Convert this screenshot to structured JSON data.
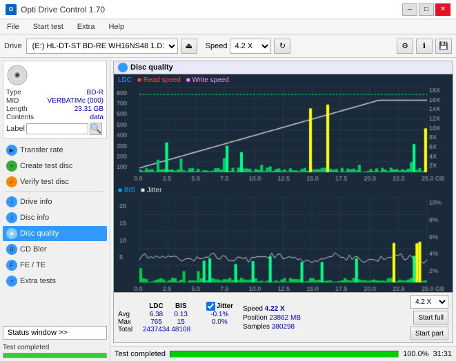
{
  "window": {
    "title": "Opti Drive Control 1.70",
    "controls": [
      "–",
      "□",
      "✕"
    ]
  },
  "menu": {
    "items": [
      "File",
      "Start test",
      "Extra",
      "Help"
    ]
  },
  "toolbar": {
    "drive_label": "Drive",
    "drive_value": "(E:)  HL-DT-ST BD-RE  WH16NS48 1.D3",
    "speed_label": "Speed",
    "speed_value": "4.2 X"
  },
  "disc": {
    "type_label": "Type",
    "type_value": "BD-R",
    "mid_label": "MID",
    "mid_value": "VERBATIMc (000)",
    "length_label": "Length",
    "length_value": "23.31 GB",
    "contents_label": "Contents",
    "contents_value": "data",
    "label_label": "Label",
    "label_value": ""
  },
  "sidebar": {
    "items": [
      {
        "id": "transfer-rate",
        "label": "Transfer rate",
        "active": false
      },
      {
        "id": "create-test-disc",
        "label": "Create test disc",
        "active": false
      },
      {
        "id": "verify-test-disc",
        "label": "Verify test disc",
        "active": false
      },
      {
        "id": "drive-info",
        "label": "Drive info",
        "active": false
      },
      {
        "id": "disc-info",
        "label": "Disc info",
        "active": false
      },
      {
        "id": "disc-quality",
        "label": "Disc quality",
        "active": true
      },
      {
        "id": "cd-bler",
        "label": "CD Bler",
        "active": false
      },
      {
        "id": "fe-te",
        "label": "FE / TE",
        "active": false
      },
      {
        "id": "extra-tests",
        "label": "Extra tests",
        "active": false
      }
    ],
    "status_window_label": "Status window >>"
  },
  "disc_quality": {
    "title": "Disc quality",
    "chart1": {
      "legend": {
        "ldc": "LDC",
        "read": "Read speed",
        "write": "Write speed"
      },
      "y_max": 800,
      "y_labels": [
        "800",
        "700",
        "600",
        "500",
        "400",
        "300",
        "200",
        "100"
      ],
      "y_right_labels": [
        "18X",
        "16X",
        "14X",
        "12X",
        "10X",
        "8X",
        "6X",
        "4X",
        "2X"
      ],
      "x_labels": [
        "0.0",
        "2.5",
        "5.0",
        "7.5",
        "10.0",
        "12.5",
        "15.0",
        "17.5",
        "20.0",
        "22.5",
        "25.0 GB"
      ]
    },
    "chart2": {
      "legend": {
        "bis": "BIS",
        "jitter": "Jitter"
      },
      "y_labels": [
        "20",
        "15",
        "10",
        "5"
      ],
      "y_right_labels": [
        "10%",
        "8%",
        "6%",
        "4%",
        "2%"
      ],
      "x_labels": [
        "0.0",
        "2.5",
        "5.0",
        "7.5",
        "10.0",
        "12.5",
        "15.0",
        "17.5",
        "20.0",
        "22.5",
        "25.0 GB"
      ]
    },
    "stats": {
      "headers": [
        "LDC",
        "BIS",
        "",
        "Jitter",
        "Speed",
        ""
      ],
      "avg_label": "Avg",
      "avg_ldc": "6.38",
      "avg_bis": "0.13",
      "avg_jitter": "-0.1%",
      "max_label": "Max",
      "max_ldc": "765",
      "max_bis": "15",
      "max_jitter": "0.0%",
      "total_label": "Total",
      "total_ldc": "2437434",
      "total_bis": "48108",
      "speed_value": "4.22 X",
      "position_label": "Position",
      "position_value": "23862 MB",
      "samples_label": "Samples",
      "samples_value": "380298",
      "speed_select": "4.2 X",
      "btn_start_full": "Start full",
      "btn_start_part": "Start part",
      "jitter_checked": true
    }
  },
  "status_bar": {
    "message": "Test completed",
    "progress": 100,
    "time": "31:31"
  }
}
